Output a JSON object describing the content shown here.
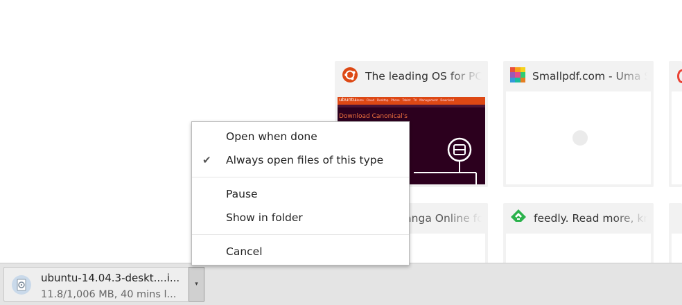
{
  "tiles": [
    {
      "title": "The leading OS for PC",
      "icon": "ubuntu-icon"
    },
    {
      "title": "Smallpdf.com - Uma Solução",
      "icon": "smallpdf-icon"
    },
    {
      "title": "anga Online for",
      "icon": "manga-icon"
    },
    {
      "title": "feedly. Read more, know",
      "icon": "feedly-icon"
    }
  ],
  "ubuntu_thumb": {
    "headline": "Download Canonical's",
    "brand": "ubuntu",
    "nav": [
      "Home",
      "Cloud",
      "Desktop",
      "Phone",
      "Tablet",
      "TV",
      "Management",
      "Download"
    ]
  },
  "context_menu": {
    "items": [
      {
        "label": "Open when done",
        "checked": false
      },
      {
        "label": "Always open files of this type",
        "checked": true
      },
      {
        "label": "Pause"
      },
      {
        "label": "Show in folder"
      },
      {
        "label": "Cancel"
      }
    ],
    "check_glyph": "✔"
  },
  "download": {
    "filename": "ubuntu-14.04.3-deskt....i...",
    "status": "11.8/1,006 MB, 40 mins l...",
    "dropdown_glyph": "▾"
  },
  "colors": {
    "ubuntu_orange": "#dd4814",
    "ubuntu_purple": "#2c001e",
    "feedly_green": "#2bb24c",
    "bar_background": "#e4e4e4"
  }
}
